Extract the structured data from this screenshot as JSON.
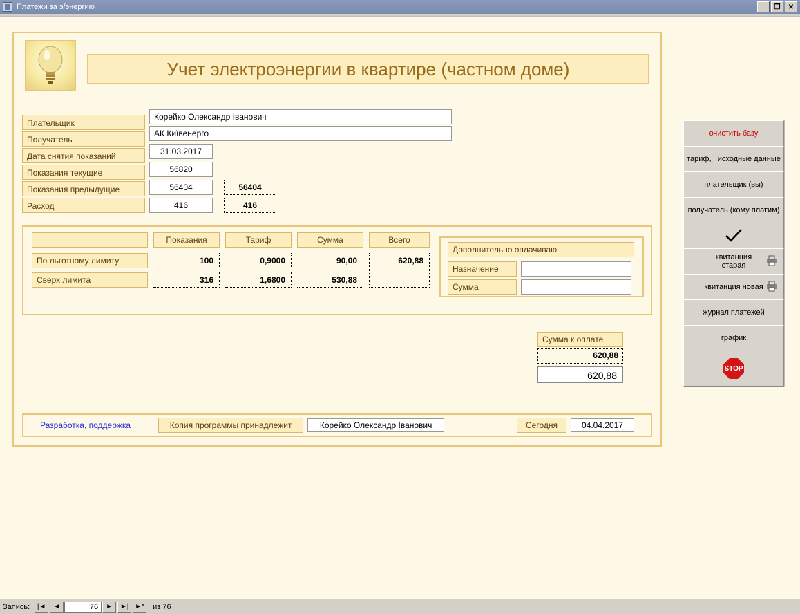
{
  "window": {
    "title": "Платежи за э/энергию",
    "min": "_",
    "restore": "❐",
    "close": "✕"
  },
  "header": {
    "title": "Учет электроэнергии в квартире (частном доме)"
  },
  "info": {
    "labels": {
      "payer": "Плательщик",
      "recipient": "Получатель",
      "read_date": "Дата снятия показаний",
      "current": "Показания текущие",
      "previous": "Показания предыдущие",
      "consumption": "Расход"
    },
    "payer": "Корейко Олександр Іванович",
    "recipient": "АК Київенерго",
    "read_date": "31.03.2017",
    "current": "56820",
    "previous": "56404",
    "previous_dup": "56404",
    "consumption": "416",
    "consumption_dup": "416"
  },
  "calc": {
    "headers": {
      "readings": "Показания",
      "tariff": "Тариф",
      "amount": "Сумма",
      "total": "Всего"
    },
    "rows": [
      {
        "label": "По льготному лимиту",
        "readings": "100",
        "tariff": "0,9000",
        "amount": "90,00"
      },
      {
        "label": "Сверх лимита",
        "readings": "316",
        "tariff": "1,6800",
        "amount": "530,88"
      }
    ],
    "total": "620,88"
  },
  "additional": {
    "title": "Дополнительно оплачиваю",
    "purpose_label": "Назначение",
    "sum_label": "Сумма",
    "purpose": "",
    "sum": ""
  },
  "summary": {
    "label": "Сумма к оплате",
    "calc": "620,88",
    "final": "620,88"
  },
  "footer": {
    "dev_link": "Разработка, поддержка",
    "copy_label": "Копия программы принадлежит",
    "owner": "Корейко Олександр Іванович",
    "today_label": "Сегодня",
    "today": "04.04.2017"
  },
  "sidebar": {
    "clear": "очистить базу",
    "tariff": "тариф,   исходные данные",
    "payer": "плательщик (вы)",
    "recipient": "получатель (кому платим)",
    "receipt_old": "квитанция старая",
    "receipt_new": "квитанция новая",
    "journal": "журнал платежей",
    "chart": "график",
    "stop": "STOP"
  },
  "recnav": {
    "label": "Запись:",
    "current": "76",
    "of": "из  76"
  }
}
